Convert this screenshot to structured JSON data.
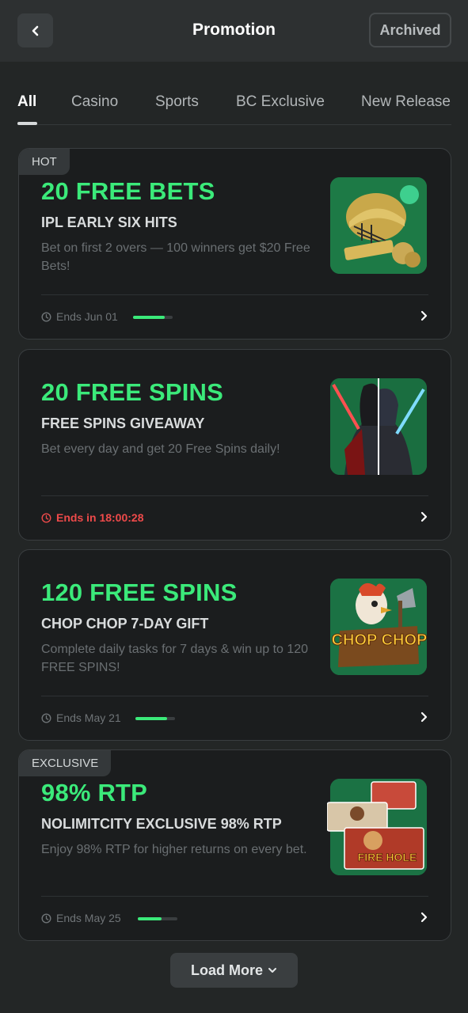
{
  "header": {
    "title": "Promotion",
    "archived_label": "Archived"
  },
  "tabs": [
    {
      "label": "All",
      "active": true
    },
    {
      "label": "Casino",
      "active": false
    },
    {
      "label": "Sports",
      "active": false
    },
    {
      "label": "BC Exclusive",
      "active": false
    },
    {
      "label": "New Release",
      "active": false
    }
  ],
  "colors": {
    "accent_green": "#3bea7a",
    "urgent_red": "#ee4a4a",
    "background": "#232626",
    "card": "#1b1d1e"
  },
  "promotions": [
    {
      "badge": "HOT",
      "headline": "20 FREE BETS",
      "subtitle": "IPL EARLY SIX HITS",
      "description": "Bet on first 2 overs — 100 winners get $20 Free Bets!",
      "ends": "Ends Jun 01",
      "urgent": false,
      "progress": 0.8,
      "image": "cricket-helmet-gold-coins-art"
    },
    {
      "badge": "",
      "headline": "20 FREE SPINS",
      "subtitle": "FREE SPINS GIVEAWAY",
      "description": "Bet every day and get 20 Free Spins daily!",
      "ends": "Ends in 18:00:28",
      "urgent": true,
      "progress": null,
      "image": "lightsaber-warriors-art"
    },
    {
      "badge": "",
      "headline": "120 FREE SPINS",
      "subtitle": "CHOP CHOP 7-DAY GIFT",
      "description": "Complete daily tasks for 7 days & win up to 120 FREE SPINS!",
      "ends": "Ends May 21",
      "urgent": false,
      "progress": 0.8,
      "image": "chop-chop-rooster-art",
      "image_text": "CHOP CHOP"
    },
    {
      "badge": "EXCLUSIVE",
      "headline": "98% RTP",
      "subtitle": "NOLIMITCITY EXCLUSIVE 98% RTP",
      "description": "Enjoy 98% RTP for higher returns on every bet.",
      "ends": "Ends May 25",
      "urgent": false,
      "progress": 0.6,
      "image": "nolimitcity-games-collage-art",
      "image_text": "FIRE HOLE"
    }
  ],
  "load_more_label": "Load More"
}
